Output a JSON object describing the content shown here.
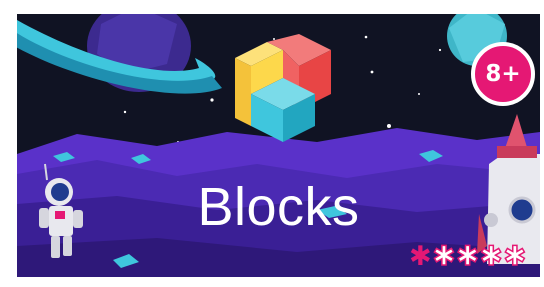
{
  "banner": {
    "title": "Blocks",
    "age_rating": "8+",
    "rating": {
      "value": 1,
      "max": 5
    }
  },
  "colors": {
    "sky": "#101323",
    "ground": "#5a31c9",
    "accent": "#e51874",
    "logo_yellow": "#fdd84b",
    "logo_red": "#ef4e4e",
    "logo_cyan": "#3fc6dd"
  },
  "icons": [
    "blocks-logo-icon",
    "planet-icon",
    "astronaut-icon",
    "rocket-icon",
    "star-icon"
  ]
}
